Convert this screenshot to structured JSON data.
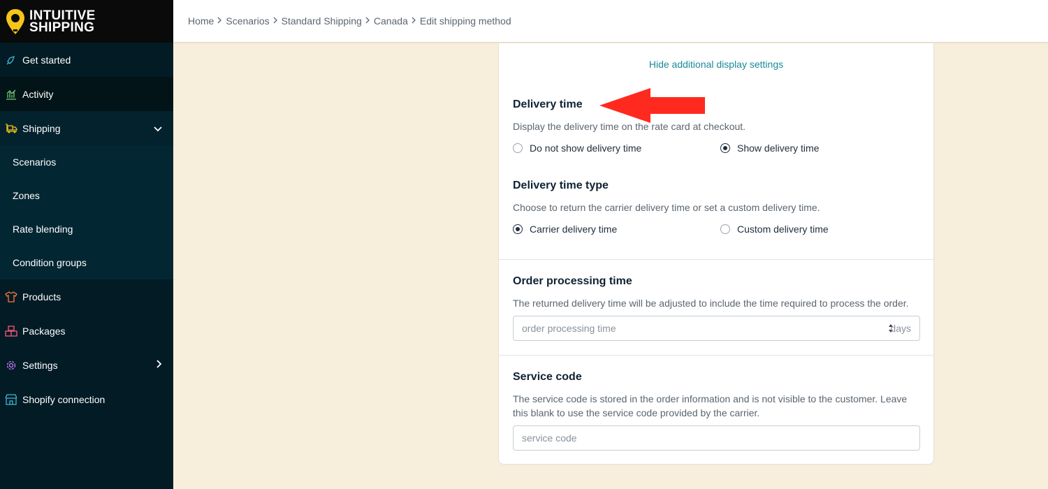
{
  "brand": {
    "line1": "INTUITIVE",
    "line2": "SHIPPING"
  },
  "sidebar": {
    "items": [
      {
        "label": "Get started",
        "icon": "rocket-icon"
      },
      {
        "label": "Activity",
        "icon": "chart-icon"
      },
      {
        "label": "Shipping",
        "icon": "truck-icon"
      },
      {
        "label": "Products",
        "icon": "shirt-icon"
      },
      {
        "label": "Packages",
        "icon": "boxes-icon"
      },
      {
        "label": "Settings",
        "icon": "gear-icon"
      },
      {
        "label": "Shopify connection",
        "icon": "store-icon"
      }
    ],
    "shipping_sub": [
      "Scenarios",
      "Zones",
      "Rate blending",
      "Condition groups"
    ]
  },
  "breadcrumb": [
    "Home",
    "Scenarios",
    "Standard Shipping",
    "Canada",
    "Edit shipping method"
  ],
  "card": {
    "hide_link": "Hide additional display settings",
    "delivery_time": {
      "title": "Delivery time",
      "desc": "Display the delivery time on the rate card at checkout.",
      "options": [
        "Do not show delivery time",
        "Show delivery time"
      ],
      "selected": "Show delivery time"
    },
    "delivery_time_type": {
      "title": "Delivery time type",
      "desc": "Choose to return the carrier delivery time or set a custom delivery time.",
      "options": [
        "Carrier delivery time",
        "Custom delivery time"
      ],
      "selected": "Carrier delivery time"
    },
    "order_processing": {
      "title": "Order processing time",
      "desc": "The returned delivery time will be adjusted to include the time required to process the order.",
      "placeholder": "order processing time",
      "suffix": "days"
    },
    "service_code": {
      "title": "Service code",
      "desc_line1": "The service code is stored in the order information and is not visible to the customer. Leave",
      "desc_line2": "this blank to use the service code provided by the carrier.",
      "placeholder": "service code"
    }
  },
  "colors": {
    "sidebar": "#021b25",
    "accent": "#1a8a9a",
    "annotation": "#ff2a1f",
    "background": "#f7eedb"
  }
}
